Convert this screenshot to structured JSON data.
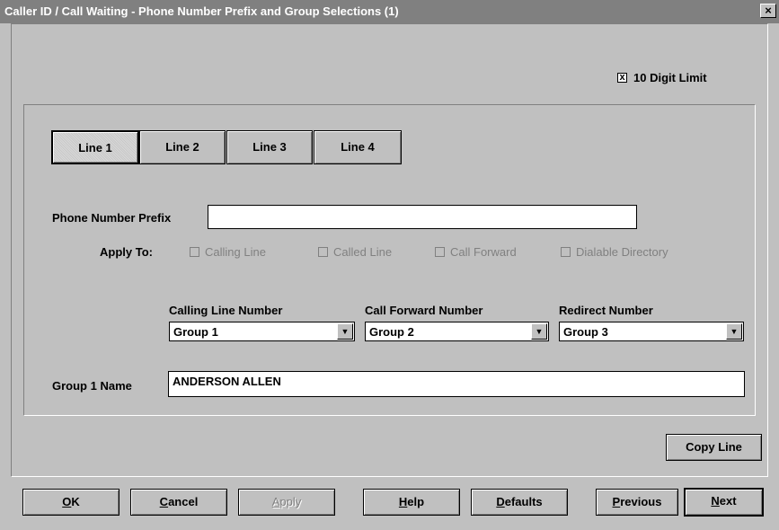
{
  "window": {
    "title": "Caller ID / Call Waiting - Phone Number Prefix and Group Selections (1)",
    "close_glyph": "×"
  },
  "digit_limit": {
    "label": "10 Digit Limit",
    "checked": true,
    "mark": "x"
  },
  "tabs": [
    {
      "label": "Line 1",
      "active": true
    },
    {
      "label": "Line 2",
      "active": false
    },
    {
      "label": "Line 3",
      "active": false
    },
    {
      "label": "Line 4",
      "active": false
    }
  ],
  "prefix": {
    "label": "Phone Number Prefix",
    "value": ""
  },
  "apply_to": {
    "label": "Apply To:",
    "options": [
      {
        "label": "Calling Line",
        "checked": false,
        "enabled": false
      },
      {
        "label": "Called Line",
        "checked": false,
        "enabled": false
      },
      {
        "label": "Call Forward",
        "checked": false,
        "enabled": false
      },
      {
        "label": "Dialable Directory",
        "checked": false,
        "enabled": false
      }
    ]
  },
  "selects": [
    {
      "label": "Calling Line Number",
      "value": "Group 1"
    },
    {
      "label": "Call Forward Number",
      "value": "Group 2"
    },
    {
      "label": "Redirect Number",
      "value": "Group 3"
    }
  ],
  "group_name": {
    "label": "Group 1 Name",
    "value": "ANDERSON ALLEN"
  },
  "copy_line": "Copy Line",
  "buttons": {
    "ok": {
      "key": "O",
      "rest": "K"
    },
    "cancel": {
      "key": "C",
      "rest": "ancel"
    },
    "apply": {
      "key": "A",
      "rest": "pply"
    },
    "help": {
      "key": "H",
      "rest": "elp"
    },
    "defaults": {
      "key": "D",
      "rest": "efaults"
    },
    "previous": {
      "key": "P",
      "rest": "revious"
    },
    "next": {
      "key": "N",
      "rest": "ext"
    }
  },
  "icons": {
    "dropdown": "▼"
  },
  "colors": {
    "face": "#c0c0c0",
    "titlebar": "#808080",
    "disabled_text": "#808080"
  }
}
